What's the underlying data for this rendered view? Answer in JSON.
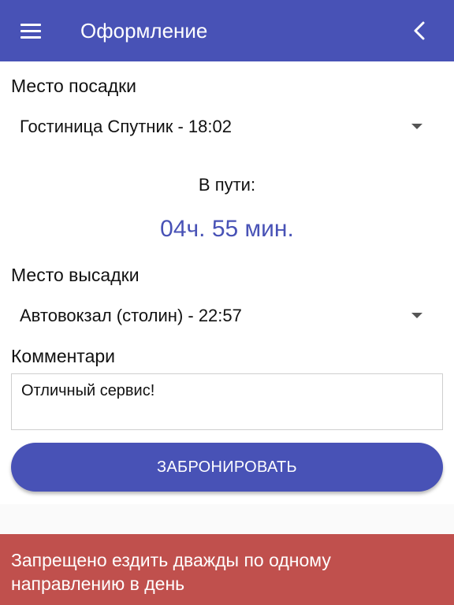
{
  "app_bar": {
    "title": "Оформление",
    "menu_icon": "hamburger-menu-icon",
    "back_icon": "chevron-left-icon"
  },
  "pickup": {
    "label": "Место посадки",
    "selected": "Гостиница Спутник - 18:02"
  },
  "travel": {
    "label": "В пути:",
    "duration": "04ч. 55 мин."
  },
  "dropoff": {
    "label": "Место высадки",
    "selected": "Автовокзал (столин) - 22:57"
  },
  "comment": {
    "label": "Комментари",
    "value": "Отличный сервис!"
  },
  "book_button": {
    "label": "ЗАБРОНИРОВАТЬ"
  },
  "error": {
    "message": "Запрещено ездить дважды по одному направлению в день"
  },
  "colors": {
    "primary": "#4852b6",
    "error": "#c0504d"
  }
}
